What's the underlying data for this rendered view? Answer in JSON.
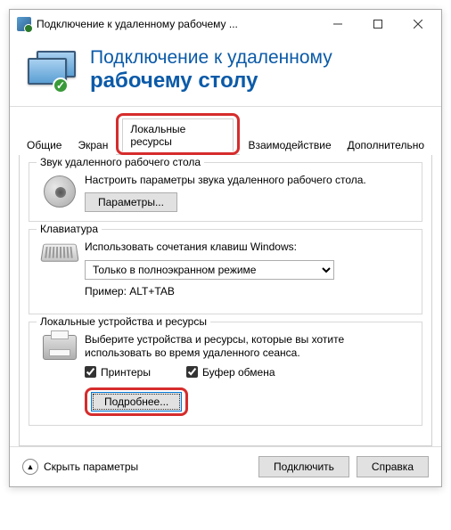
{
  "titlebar": {
    "text": "Подключение к удаленному рабочему ..."
  },
  "header": {
    "line1": "Подключение к удаленному",
    "line2": "рабочему столу"
  },
  "tabs": {
    "general": "Общие",
    "screen": "Экран",
    "local": "Локальные ресурсы",
    "interaction": "Взаимодействие",
    "advanced": "Дополнительно"
  },
  "sound": {
    "title": "Звук удаленного рабочего стола",
    "desc": "Настроить параметры звука удаленного рабочего стола.",
    "btn": "Параметры..."
  },
  "keyboard": {
    "title": "Клавиатура",
    "desc": "Использовать сочетания клавиш Windows:",
    "selected": "Только в полноэкранном режиме",
    "example": "Пример: ALT+TAB"
  },
  "devices": {
    "title": "Локальные устройства и ресурсы",
    "desc": "Выберите устройства и ресурсы, которые вы хотите использовать во время удаленного сеанса.",
    "printers": "Принтеры",
    "clipboard": "Буфер обмена",
    "more": "Подробнее..."
  },
  "footer": {
    "collapse": "Скрыть параметры",
    "connect": "Подключить",
    "help": "Справка"
  }
}
